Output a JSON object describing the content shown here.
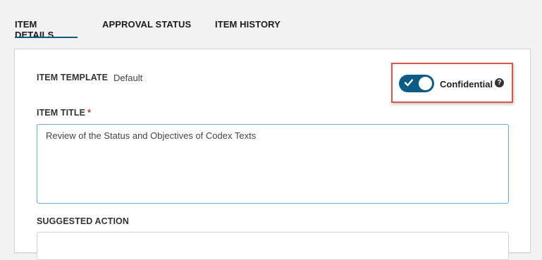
{
  "tabs": [
    {
      "label": "ITEM DETAILS",
      "active": true
    },
    {
      "label": "APPROVAL STATUS",
      "active": false
    },
    {
      "label": "ITEM HISTORY",
      "active": false
    }
  ],
  "form": {
    "template_label": "ITEM TEMPLATE",
    "template_value": "Default",
    "confidential_toggle": {
      "label": "Confidential",
      "on": true,
      "help_icon": "question-circle-icon"
    },
    "title_label": "ITEM TITLE",
    "required_marker": "*",
    "title_value": "Review of the Status and Objectives of Codex Texts",
    "suggested_action_label": "SUGGESTED ACTION",
    "suggested_action_value": ""
  },
  "colors": {
    "accent": "#0d5c86",
    "highlight_border": "#d9574b",
    "input_focus_border": "#6da8d3",
    "required": "#c0392b"
  }
}
